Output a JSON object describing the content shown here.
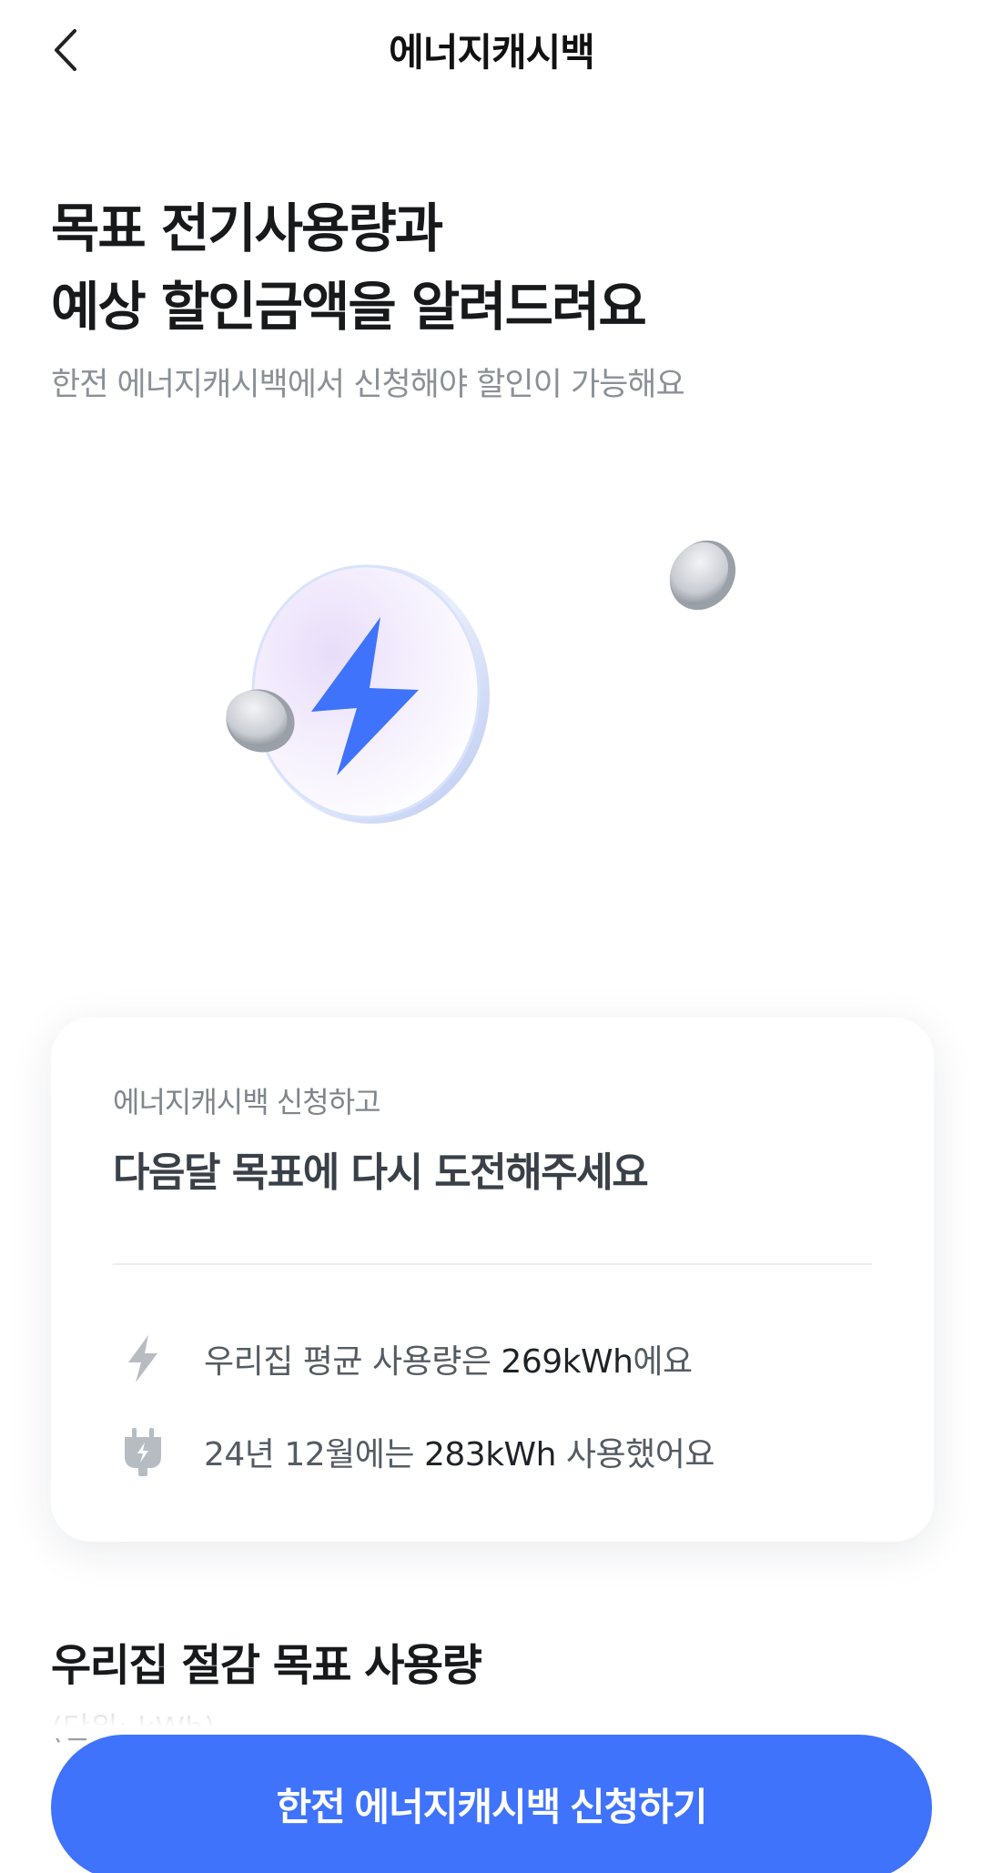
{
  "header": {
    "title": "에너지캐시백"
  },
  "hero": {
    "title_line1": "목표 전기사용량과",
    "title_line2": "예상 할인금액을 알려드려요",
    "subtitle": "한전 에너지캐시백에서 신청해야 할인이 가능해요"
  },
  "card": {
    "subtitle": "에너지캐시백 신청하고",
    "title": "다음달 목표에 다시 도전해주세요",
    "rows": [
      {
        "icon": "lightning-icon",
        "prefix": "우리집 평균 사용량은 ",
        "value": "269kWh",
        "suffix": "에요"
      },
      {
        "icon": "plug-icon",
        "prefix": "24년 12월에는 ",
        "value": "283kWh",
        "suffix": " 사용했어요"
      }
    ]
  },
  "section": {
    "title": "우리집 절감 목표 사용량",
    "unit": "(단위: kWh)"
  },
  "cta": {
    "label": "한전 에너지캐시백 신청하기"
  },
  "colors": {
    "accent": "#3f73fc",
    "bolt": "#3f73fc",
    "icon_gray": "#b7bcc3"
  }
}
